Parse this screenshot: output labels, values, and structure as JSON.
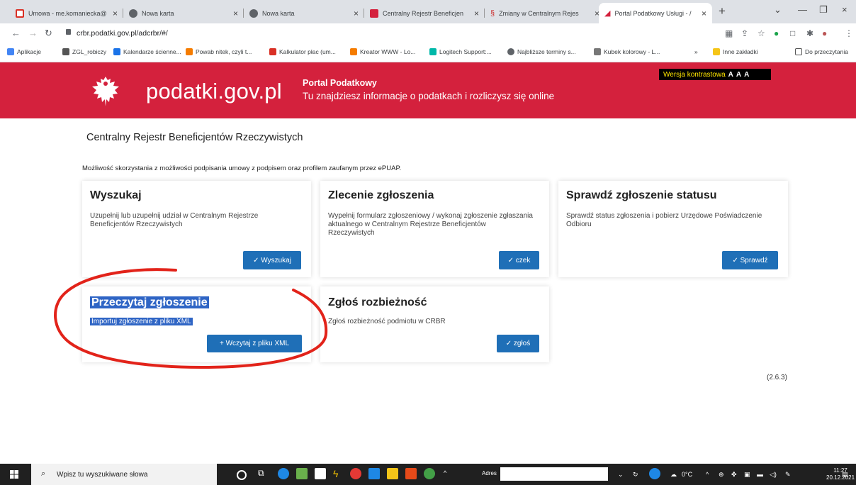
{
  "browser": {
    "tabs": [
      {
        "title": "Umowa - me.komaniecka@",
        "favicon_color": "#d93025"
      },
      {
        "title": "Nowa karta",
        "favicon_color": "#5f6368"
      },
      {
        "title": "Nowa karta",
        "favicon_color": "#5f6368"
      },
      {
        "title": "Centralny Rejestr Beneficjen",
        "favicon_color": "#d4213d"
      },
      {
        "title": "Zmiany w Centralnym Rejes",
        "favicon_color": "#c33"
      },
      {
        "title": "Portal Podatkowy Usługi - /",
        "favicon_color": "#d4213d"
      }
    ],
    "new_tab": "+",
    "url": "crbr.podatki.gov.pl/adcrbr/#/",
    "bookmarks": [
      {
        "label": "Aplikacje",
        "color": "#4285f4"
      },
      {
        "label": "ZGL_robiczy",
        "color": "#555"
      },
      {
        "label": "Kalendarze ścienne...",
        "color": "#1a73e8"
      },
      {
        "label": "Powab nitek, czyli t...",
        "color": "#f57c00"
      },
      {
        "label": "Kalkulator płac (um...",
        "color": "#d93025"
      },
      {
        "label": "Kreator WWW - Lo...",
        "color": "#f57c00"
      },
      {
        "label": "Logitech Support:...",
        "color": "#00b8a9"
      },
      {
        "label": "Najbliższe terminy s...",
        "color": "#5f6368"
      },
      {
        "label": "Kubek kolorowy - L...",
        "color": "#777"
      }
    ],
    "bookmarks_more": "»",
    "other_bookmarks": "Inne zakładki",
    "reading_list": "Do przeczytania"
  },
  "header": {
    "brand": "podatki.gov.pl",
    "portal_title": "Portal Podatkowy",
    "portal_subtitle": "Tu znajdziesz informacje o podatkach i rozliczysz się online",
    "contrast_label": "Wersja kontrastowa",
    "font_sizes": "A A A"
  },
  "main": {
    "heading": "Centralny Rejestr Beneficjentów Rzeczywistych",
    "info": "Możliwość skorzystania z możliwości podpisania umowy z podpisem oraz profilem zaufanym przez ePUAP.",
    "cards": [
      {
        "title": "Wyszukaj",
        "desc": "Uzupełnij lub uzupełnij udział w Centralnym Rejestrze Beneficjentów Rzeczywistych",
        "button": "✓  Wyszukaj"
      },
      {
        "title": "Zlecenie zgłoszenia",
        "desc": "Wypełnij formularz zgłoszeniowy / wykonaj zgłoszenie zgłaszania aktualnego w Centralnym Rejestrze Beneficjentów Rzeczywistych",
        "button": "✓  czek"
      },
      {
        "title": "Sprawdź zgłoszenie statusu",
        "desc": "Sprawdź status zgłoszenia i pobierz Urzędowe Poświadczenie Odbioru",
        "button": "✓  Sprawdź"
      },
      {
        "title": "Przeczytaj zgłoszenie",
        "desc": "Importuj zgłoszenie z pliku XML",
        "button": "+ Wczytaj z pliku XML"
      },
      {
        "title": "Zgłoś rozbieżność",
        "desc": "Zgłoś rozbieżność podmiotu w CRBR",
        "button": "✓  zgłoś"
      }
    ],
    "version": "(2.6.3)"
  },
  "taskbar": {
    "search_placeholder": "Wpisz tu wyszukiwane słowa",
    "address_label": "Adres",
    "weather": "0°C",
    "time": "11:27",
    "date": "20.12.2021"
  },
  "colors": {
    "brand_red": "#d4213d",
    "button_blue": "#1f6fb7",
    "highlight": "#2f65c5",
    "annotation": "#e2231a"
  }
}
